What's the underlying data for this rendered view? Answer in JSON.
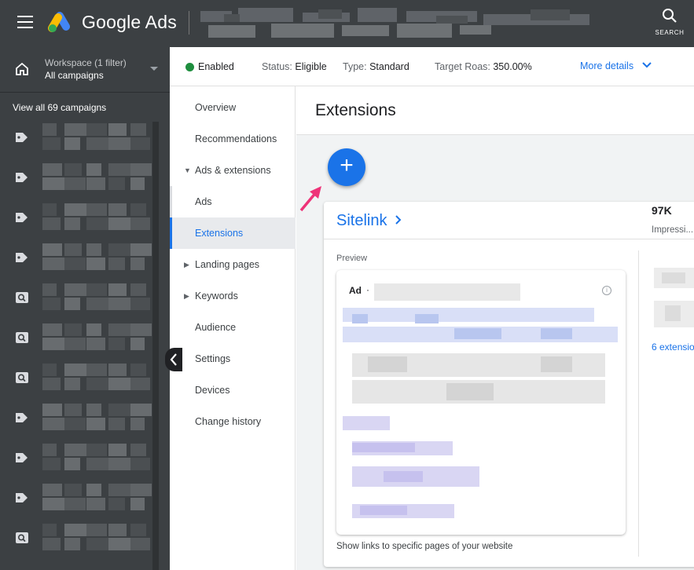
{
  "header": {
    "brand": "Google Ads",
    "search_label": "SEARCH"
  },
  "workspace": {
    "line1": "Workspace (1 filter)",
    "line2": "All campaigns"
  },
  "sidebar": {
    "view_all": "View all 69 campaigns",
    "campaigns": [
      {
        "icon": "tag-icon"
      },
      {
        "icon": "tag-icon"
      },
      {
        "icon": "tag-icon"
      },
      {
        "icon": "tag-icon"
      },
      {
        "icon": "search-icon"
      },
      {
        "icon": "search-icon"
      },
      {
        "icon": "search-icon"
      },
      {
        "icon": "tag-icon"
      },
      {
        "icon": "tag-icon"
      },
      {
        "icon": "tag-icon"
      },
      {
        "icon": "search-icon"
      }
    ]
  },
  "status_bar": {
    "enabled": "Enabled",
    "status_label": "Status:",
    "status_value": "Eligible",
    "type_label": "Type:",
    "type_value": "Standard",
    "roas_label": "Target Roas:",
    "roas_value": "350.00%",
    "more_details": "More details"
  },
  "page_nav": {
    "items": [
      {
        "label": "Overview"
      },
      {
        "label": "Recommendations"
      },
      {
        "label": "Ads & extensions"
      },
      {
        "label": "Ads"
      },
      {
        "label": "Extensions"
      },
      {
        "label": "Landing pages"
      },
      {
        "label": "Keywords"
      },
      {
        "label": "Audience"
      },
      {
        "label": "Settings"
      },
      {
        "label": "Devices"
      },
      {
        "label": "Change history"
      }
    ]
  },
  "main": {
    "title": "Extensions",
    "fab_glyph": "+",
    "card": {
      "title": "Sitelink",
      "impressions_value": "97K",
      "impressions_label": "Impressi...",
      "preview_label": "Preview",
      "ad_badge": "Ad",
      "ad_dot": "·",
      "footer": "Show links to specific pages of your website",
      "extensions_link": "6 extensio"
    }
  },
  "colors": {
    "header_bg": "#3c4043",
    "accent_blue": "#1a73e8",
    "enabled_green": "#1e8e3e",
    "arrow_pink": "#ee3378"
  }
}
